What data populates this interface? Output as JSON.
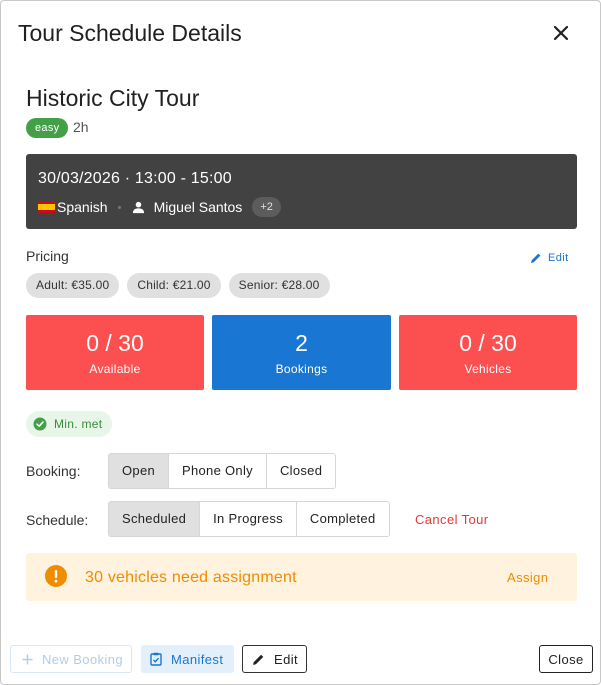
{
  "dialog": {
    "title": "Tour Schedule Details"
  },
  "tour": {
    "name": "Historic City Tour",
    "difficulty": "easy",
    "duration": "2h"
  },
  "schedule_card": {
    "date_time": "30/03/2026 · 13:00 - 15:00",
    "language": "Spanish",
    "guide": "Miguel Santos",
    "extra_guides": "+2"
  },
  "pricing": {
    "label": "Pricing",
    "edit_label": "Edit",
    "items": [
      "Adult: €35.00",
      "Child: €21.00",
      "Senior: €28.00"
    ]
  },
  "stats": {
    "available": {
      "value": "0 / 30",
      "label": "Available"
    },
    "bookings": {
      "value": "2",
      "label": "Bookings"
    },
    "vehicles": {
      "value": "0 / 30",
      "label": "Vehicles"
    }
  },
  "minimum": {
    "label": "Min. met"
  },
  "booking": {
    "label": "Booking:",
    "options": [
      "Open",
      "Phone Only",
      "Closed"
    ],
    "selected": "Open"
  },
  "schedule_status": {
    "label": "Schedule:",
    "options": [
      "Scheduled",
      "In Progress",
      "Completed"
    ],
    "selected": "Scheduled",
    "cancel_label": "Cancel Tour"
  },
  "alert": {
    "message": "30 vehicles need assignment",
    "action": "Assign"
  },
  "footer": {
    "new_booking": "New Booking",
    "manifest": "Manifest",
    "edit": "Edit",
    "close": "Close"
  },
  "colors": {
    "danger": "#fc5050",
    "primary": "#1976d2",
    "success": "#43a047",
    "warning": "#ef8c00",
    "dark_card": "#424242"
  }
}
